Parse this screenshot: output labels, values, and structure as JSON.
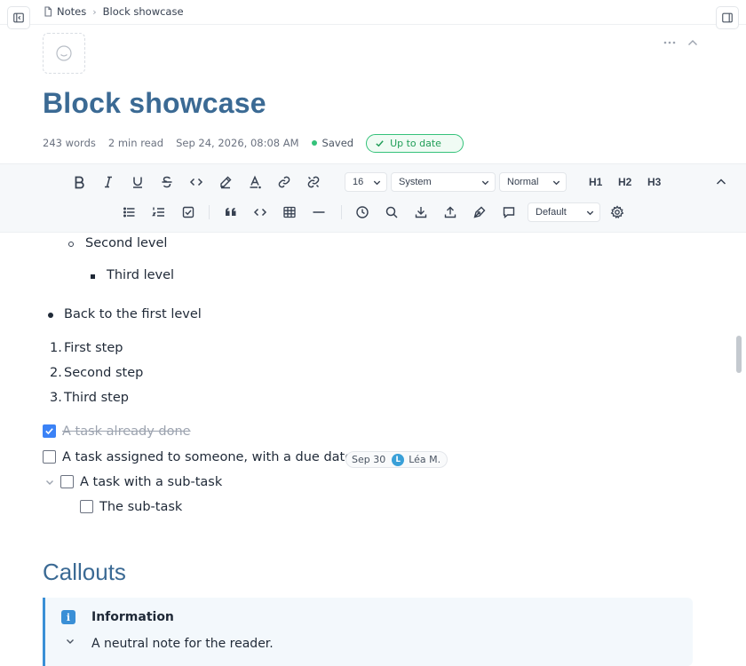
{
  "breadcrumb": {
    "root": "Notes",
    "current": "Block showcase"
  },
  "page": {
    "title": "Block showcase"
  },
  "meta": {
    "words": "243 words",
    "read_time": "2 min read",
    "timestamp": "Sep 24, 2026, 08:08 AM",
    "saved": "Saved",
    "status_badge": "Up to date"
  },
  "toolbar": {
    "font_size": "16",
    "font_family": "System",
    "block_style": "Normal",
    "h1": "H1",
    "h2": "H2",
    "h3": "H3",
    "theme": "Default"
  },
  "content": {
    "bullet_level2": "Second level",
    "bullet_level3": "Third level",
    "bullet_level1": "Back to the first level",
    "ordered": [
      {
        "num": "1.",
        "text": "First step"
      },
      {
        "num": "2.",
        "text": "Second step"
      },
      {
        "num": "3.",
        "text": "Third step"
      }
    ],
    "task_done": "A task already done",
    "task_assigned": "A task assigned to someone, with a due date",
    "task_due": "Sep 30",
    "task_assignee_initial": "L",
    "task_assignee": "Léa M.",
    "task_parent": "A task with a sub-task",
    "task_sub": "The sub-task",
    "heading_callouts": "Callouts",
    "callout_info_icon": "i",
    "callout_info_title": "Information",
    "callout_info_body": "A neutral note for the reader."
  },
  "colors": {
    "title": "#3b6a94",
    "accent": "#3a8fd6",
    "success": "#34c27a",
    "checkbox": "#3b82f6"
  }
}
